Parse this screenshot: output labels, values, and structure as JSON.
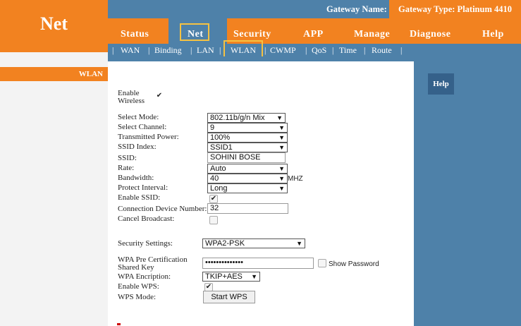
{
  "header": {
    "logo": "Net",
    "gateway_name": "Gateway Name:",
    "gateway_type": "Gateway Type: Platinum 4410"
  },
  "nav": {
    "items": [
      "Status",
      "Net",
      "Security",
      "APP",
      "Manage",
      "Diagnose",
      "Help"
    ],
    "active": "Net"
  },
  "subnav": {
    "items": [
      "WAN",
      "Binding",
      "LAN",
      "WLAN",
      "CWMP",
      "QoS",
      "Time",
      "Route"
    ],
    "active": "WLAN"
  },
  "sidebar": {
    "item": "WLAN"
  },
  "help": {
    "label": "Help"
  },
  "form": {
    "enable_wireless_line1": "Enable",
    "enable_wireless_line2": "Wireless",
    "enable_wireless_checked": true,
    "select_mode_label": "Select Mode:",
    "select_mode_value": "802.11b/g/n Mix",
    "select_channel_label": "Select Channel:",
    "select_channel_value": "9",
    "transmitted_power_label": "Transmitted Power:",
    "transmitted_power_value": "100%",
    "ssid_index_label": "SSID Index:",
    "ssid_index_value": "SSID1",
    "ssid_label": "SSID:",
    "ssid_value": "SOHINI BOSE",
    "rate_label": "Rate:",
    "rate_value": "Auto",
    "bandwidth_label": "Bandwidth:",
    "bandwidth_value": "40",
    "bandwidth_unit": "MHZ",
    "protect_interval_label": "Protect Interval:",
    "protect_interval_value": "Long",
    "enable_ssid_label": "Enable SSID:",
    "enable_ssid_checked": true,
    "connection_device_number_label": "Connection Device Number:",
    "connection_device_number_value": "32",
    "cancel_broadcast_label": "Cancel Broadcast:",
    "cancel_broadcast_checked": false,
    "security_settings_label": "Security Settings:",
    "security_settings_value": "WPA2-PSK",
    "wpa_key_label_line1": "WPA Pre Certification",
    "wpa_key_label_line2": "Shared Key",
    "wpa_key_value": "••••••••••••••",
    "show_password_label": "Show Password",
    "show_password_checked": false,
    "wpa_encryption_label": "WPA Encription:",
    "wpa_encryption_value": "TKIP+AES",
    "enable_wps_label": "Enable WPS:",
    "enable_wps_checked": true,
    "wps_mode_label": "WPS Mode:",
    "start_wps_label": "Start WPS"
  },
  "icons": {
    "dropdown": "dropdown-arrow-icon",
    "check": "checkmark-icon"
  },
  "colors": {
    "orange": "#f28220",
    "blue": "#4e81a9",
    "highlight": "#f5c242"
  }
}
